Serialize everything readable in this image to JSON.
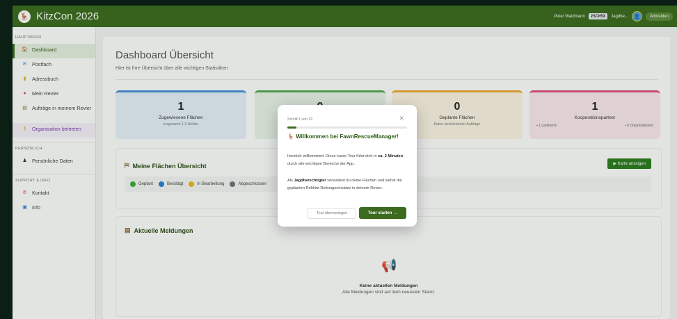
{
  "header": {
    "title": "KitzCon 2026",
    "user_name": "Peter Waidmann",
    "user_badge": "2SCH5X",
    "user_role": "Jagdbe...",
    "logout_label": "Abmelden",
    "accent": "#3c6b1f"
  },
  "sidebar": {
    "section_main": "HAUPTMENÜ",
    "items_main": [
      {
        "label": "Dashboard",
        "icon": "home-icon",
        "active": true
      },
      {
        "label": "Postfach",
        "icon": "mail-icon"
      },
      {
        "label": "Adressbuch",
        "icon": "book-icon"
      },
      {
        "label": "Mein Revier",
        "icon": "map-pin-icon"
      },
      {
        "label": "Aufträge in meinem Revier",
        "icon": "clipboard-icon"
      },
      {
        "label": "Organisation beitreten",
        "icon": "key-icon"
      }
    ],
    "section_personal": "PERSÖNLICH",
    "items_personal": [
      {
        "label": "Persönliche Daten",
        "icon": "user-icon"
      }
    ],
    "section_support": "SUPPORT & INFO",
    "items_support": [
      {
        "label": "Kontakt",
        "icon": "phone-icon"
      },
      {
        "label": "Info",
        "icon": "info-icon"
      }
    ]
  },
  "main": {
    "title": "Dashboard Übersicht",
    "subtitle": "Hier ist Ihre Übersicht über alle wichtigen Statistiken",
    "stats": [
      {
        "value": "1",
        "label": "Zugewiesene Flächen",
        "sub": "Insgesamt 1.3 Hektar",
        "color": "#4a90d9"
      },
      {
        "value": "0",
        "label": "",
        "sub": "",
        "color": "#52a852"
      },
      {
        "value": "0",
        "label": "Geplante Flächen",
        "sub": "Keine anstehenden Aufträge",
        "color": "#f0a830"
      },
      {
        "value": "1",
        "label": "Kooperationspartner",
        "sub_left": "1 Landwirte",
        "sub_right": "0 Organisationen",
        "color": "#e0507a"
      }
    ],
    "flaechen": {
      "title": "Meine Flächen Übersicht",
      "map_button": "Karte anzeigen",
      "legend": [
        {
          "label": "Geplant",
          "color": "#3cae3c"
        },
        {
          "label": "Bestätigt",
          "color": "#2b7fd9"
        },
        {
          "label": "In Bearbeitung",
          "color": "#f2b51d"
        },
        {
          "label": "Abgeschlossen",
          "color": "#6c757d"
        }
      ]
    },
    "meldungen": {
      "title": "Aktuelle Meldungen",
      "empty_title": "Keine aktuellen Meldungen",
      "empty_sub": "Alle Meldungen sind auf dem neuesten Stand."
    }
  },
  "tour": {
    "step": "Schritt 1 von 13",
    "progress": 0.077,
    "title": "Willkommen bei FawnRescueManager!",
    "body1_pre": "Herzlich willkommen! Diese kurze Tour führt dich in ",
    "body1_bold": "ca. 2 Minuten",
    "body1_post": " durch alle wichtigen Bereiche der App.",
    "body2_pre": "Als ",
    "body2_bold": "Jagdberechtigter",
    "body2_post": " verwaltest du deine Flächen und siehst die geplanten Rehkitz-Rettungseinsätze in deinem Revier.",
    "skip_label": "Tour überspringen",
    "start_label": "Tour starten →"
  }
}
